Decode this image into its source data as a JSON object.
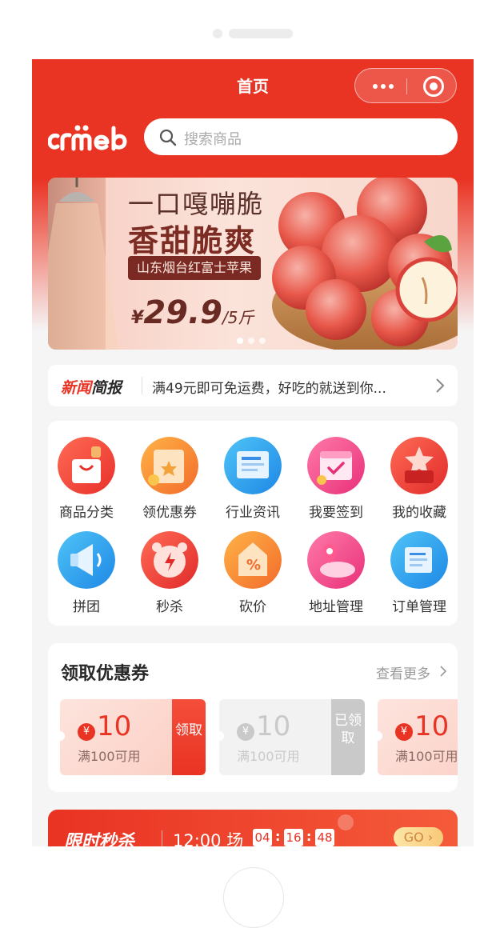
{
  "nav": {
    "title": "首页"
  },
  "search": {
    "placeholder": "搜索商品"
  },
  "banner": {
    "line1": "一口嘎嘣脆",
    "line2": "香甜脆爽",
    "tag": "山东烟台红富士苹果",
    "price_symbol": "¥",
    "price": "29.9",
    "unit": "/5斤",
    "slides": 3,
    "active_slide": 1
  },
  "news": {
    "brand_a": "新闻",
    "brand_b": "简报",
    "text": "满49元即可免运费，好吃的就送到你..."
  },
  "menu": [
    {
      "label": "商品分类",
      "icon": "shopping-bag-icon"
    },
    {
      "label": "领优惠券",
      "icon": "coupon-ticket-icon"
    },
    {
      "label": "行业资讯",
      "icon": "news-document-icon"
    },
    {
      "label": "我要签到",
      "icon": "calendar-check-icon"
    },
    {
      "label": "我的收藏",
      "icon": "star-box-icon"
    },
    {
      "label": "拼团",
      "icon": "megaphone-icon"
    },
    {
      "label": "秒杀",
      "icon": "lightning-clock-icon"
    },
    {
      "label": "砍价",
      "icon": "percent-tag-icon"
    },
    {
      "label": "地址管理",
      "icon": "location-pin-icon"
    },
    {
      "label": "订单管理",
      "icon": "order-list-icon"
    }
  ],
  "coupons": {
    "title": "领取优惠券",
    "more": "查看更多",
    "items": [
      {
        "yen": "¥",
        "amount": "10",
        "condition": "满100可用",
        "action": "领取",
        "status": "available"
      },
      {
        "yen": "¥",
        "amount": "10",
        "condition": "满100可用",
        "action": "已领取",
        "status": "received"
      },
      {
        "yen": "¥",
        "amount": "10",
        "condition": "满100可用",
        "action": "",
        "status": "available"
      }
    ]
  },
  "seckill": {
    "title": "限时秒杀",
    "session": "12:00 场",
    "hours": "04",
    "minutes": "16",
    "seconds": "48",
    "go": "GO"
  },
  "colors": {
    "brand_red": "#e93323",
    "gold": "#f8c97a",
    "text_dark": "#282828",
    "text_gray": "#999999"
  }
}
